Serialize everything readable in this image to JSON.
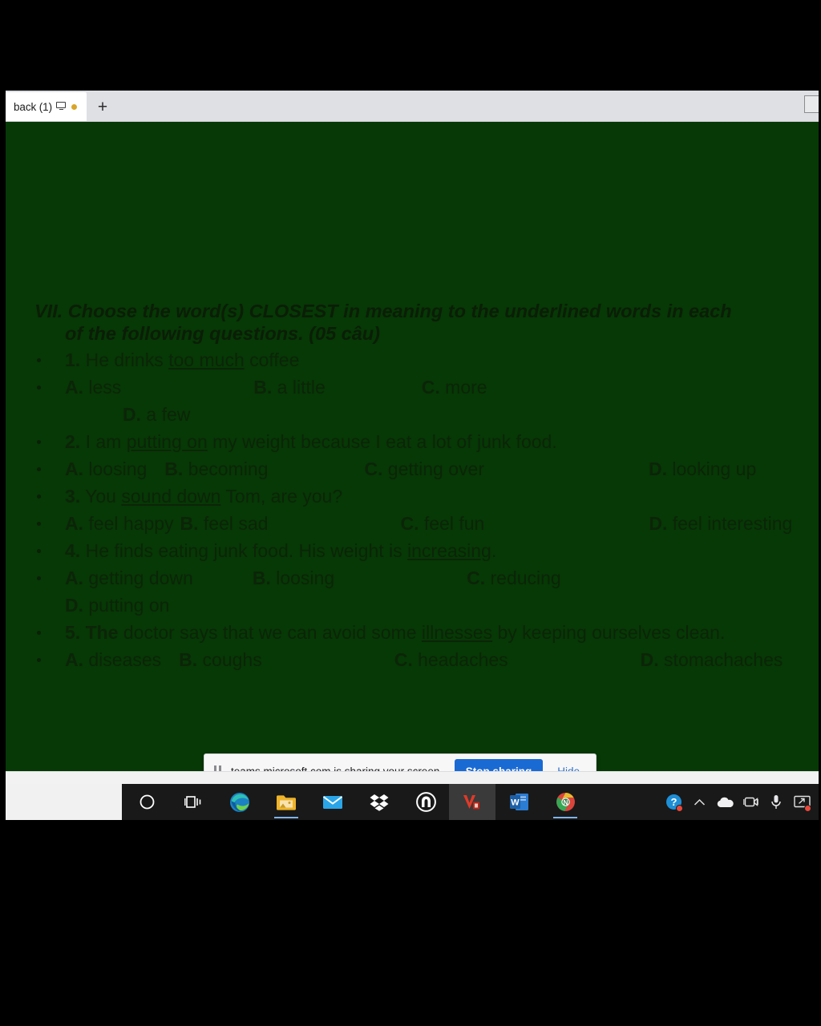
{
  "browser": {
    "tab": {
      "title": "back (1)",
      "cast_icon": "screen-cast-icon",
      "recording_dot": "recording-indicator"
    },
    "new_tab_label": "+",
    "bottom_nav": {
      "prev_label": "‹",
      "list_label": "☰",
      "next_label": "›"
    }
  },
  "slide": {
    "heading_number": "VII.",
    "heading_line1": " Choose the word(s) CLOSEST in meaning to the underlined words in each",
    "heading_line2": "of the following questions. (05 câu)",
    "questions": [
      {
        "number": "1.",
        "text_before": " He drinks ",
        "underlined": "too much",
        "text_after": " coffee",
        "options": [
          {
            "letter": "A.",
            "text": " less"
          },
          {
            "letter": "B.",
            "text": " a little"
          },
          {
            "letter": "C.",
            "text": " more"
          },
          {
            "letter": "D.",
            "text": " a few"
          }
        ]
      },
      {
        "number": "2.",
        "text_before": " I am ",
        "underlined": "putting on",
        "text_after": " my weight because I eat a lot of junk food.",
        "options": [
          {
            "letter": "A.",
            "text": " loosing"
          },
          {
            "letter": "B.",
            "text": " becoming"
          },
          {
            "letter": "C.",
            "text": " getting over"
          },
          {
            "letter": "D.",
            "text": " looking up"
          }
        ]
      },
      {
        "number": "3.",
        "text_before": " You ",
        "underlined": "sound down",
        "text_after": " Tom, are you?",
        "options": [
          {
            "letter": "A.",
            "text": " feel happy"
          },
          {
            "letter": "B.",
            "text": " feel sad"
          },
          {
            "letter": "C.",
            "text": " feel fun"
          },
          {
            "letter": "D.",
            "text": " feel interesting"
          }
        ]
      },
      {
        "number": "4.",
        "text_before": " He finds eating junk food. His weight is ",
        "underlined": "increasing",
        "text_after": ".",
        "options": [
          {
            "letter": "A.",
            "text": " getting down"
          },
          {
            "letter": "B.",
            "text": " loosing"
          },
          {
            "letter": "C.",
            "text": " reducing"
          },
          {
            "letter": "D.",
            "text": " putting on"
          }
        ]
      },
      {
        "number": "5. The",
        "text_before": " doctor says that we can avoid some ",
        "underlined": "illnesses",
        "text_after": " by keeping ourselves clean.",
        "options": [
          {
            "letter": "A.",
            "text": " diseases"
          },
          {
            "letter": "B.",
            "text": " coughs"
          },
          {
            "letter": "C.",
            "text": " headaches"
          },
          {
            "letter": "D.",
            "text": " stomachaches"
          }
        ]
      }
    ]
  },
  "share_notification": {
    "message": "teams.microsoft.com is sharing your screen.",
    "stop_label": "Stop sharing",
    "hide_label": "Hide",
    "accent_color": "#1a6ad4"
  },
  "taskbar": {
    "items": [
      {
        "name": "cortana-icon"
      },
      {
        "name": "task-view-icon"
      },
      {
        "name": "edge-browser-icon"
      },
      {
        "name": "file-explorer-icon"
      },
      {
        "name": "mail-icon"
      },
      {
        "name": "dropbox-icon"
      },
      {
        "name": "house-app-icon"
      },
      {
        "name": "v-app-icon"
      },
      {
        "name": "word-icon"
      },
      {
        "name": "chrome-icon"
      }
    ],
    "tray": [
      {
        "name": "help-icon"
      },
      {
        "name": "chevron-up-icon"
      },
      {
        "name": "onedrive-cloud-icon"
      },
      {
        "name": "camera-icon"
      },
      {
        "name": "microphone-icon"
      },
      {
        "name": "screen-share-icon"
      }
    ]
  },
  "colors": {
    "slide_background": "#063905",
    "slide_text": "#0c2408",
    "taskbar_background": "#191919"
  }
}
